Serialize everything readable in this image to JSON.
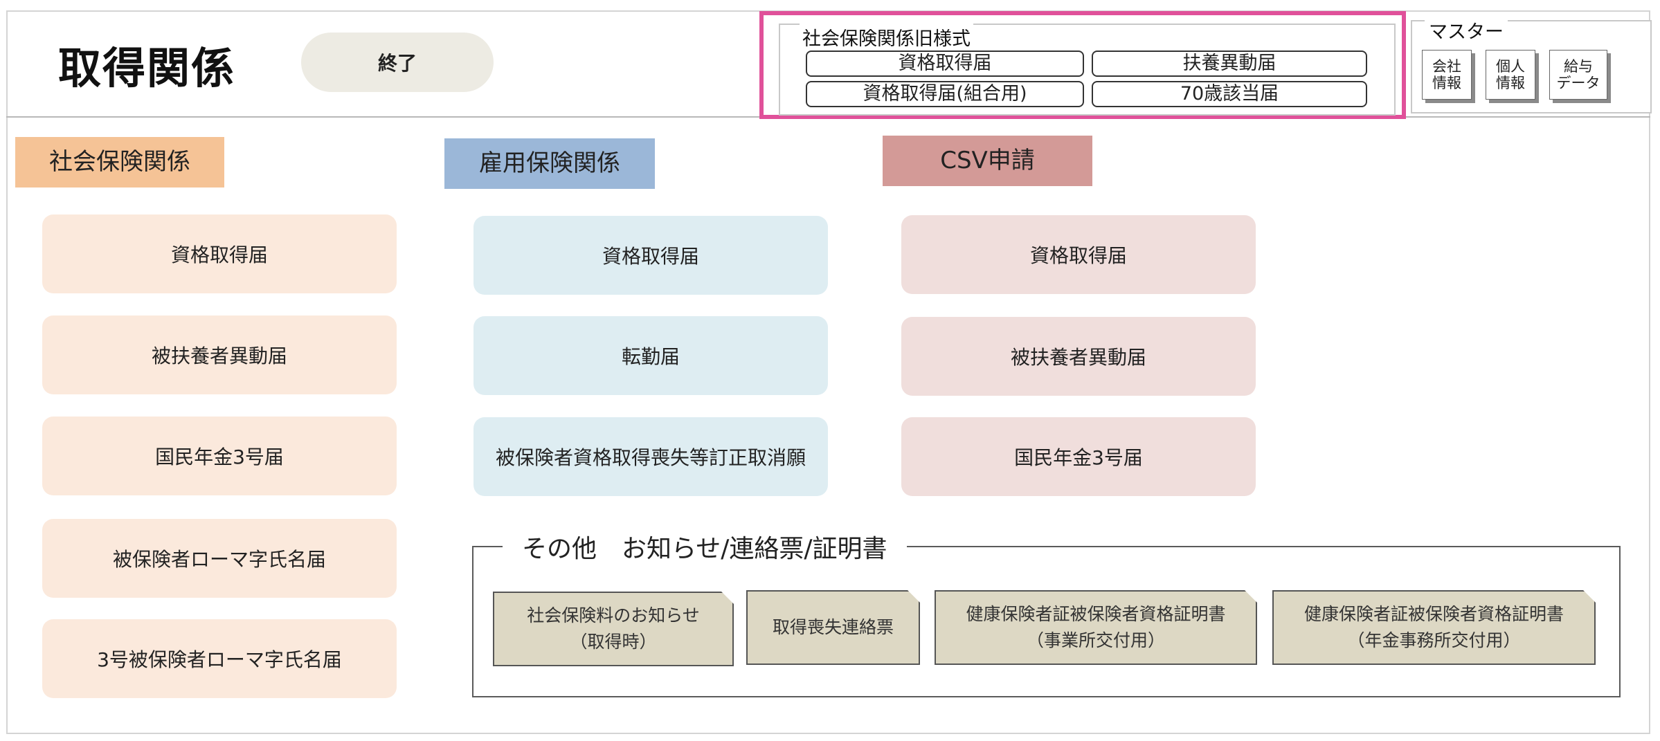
{
  "header": {
    "title": "取得関係",
    "end_button": "終了"
  },
  "old_style": {
    "label": "社会保険関係旧様式",
    "buttons": [
      "資格取得届",
      "扶養異動届",
      "資格取得届(組合用)",
      "70歳該当届"
    ]
  },
  "master": {
    "label": "マスター",
    "buttons": [
      "会社\n情報",
      "個人\n情報",
      "給与\nデータ"
    ]
  },
  "sections": {
    "social": {
      "title": "社会保険関係",
      "color": "#f5c396",
      "items": [
        "資格取得届",
        "被扶養者異動届",
        "国民年金3号届",
        "被保険者ローマ字氏名届",
        "3号被保険者ローマ字氏名届"
      ]
    },
    "employment": {
      "title": "雇用保険関係",
      "color": "#9bb7d8",
      "items": [
        "資格取得届",
        "転勤届",
        "被保険者資格取得喪失等訂正取消願"
      ]
    },
    "csv": {
      "title": "CSV申請",
      "color": "#d39a97",
      "items": [
        "資格取得届",
        "被扶養者異動届",
        "国民年金3号届"
      ]
    }
  },
  "other": {
    "label": "その他　お知らせ/連絡票/証明書",
    "items": [
      "社会保険料のお知らせ\n（取得時）",
      "取得喪失連絡票",
      "健康保険者証被保険者資格証明書\n（事業所交付用）",
      "健康保険者証被保険者資格証明書\n（年金事務所交付用）"
    ]
  },
  "colors": {
    "highlight_border": "#e0519a"
  }
}
